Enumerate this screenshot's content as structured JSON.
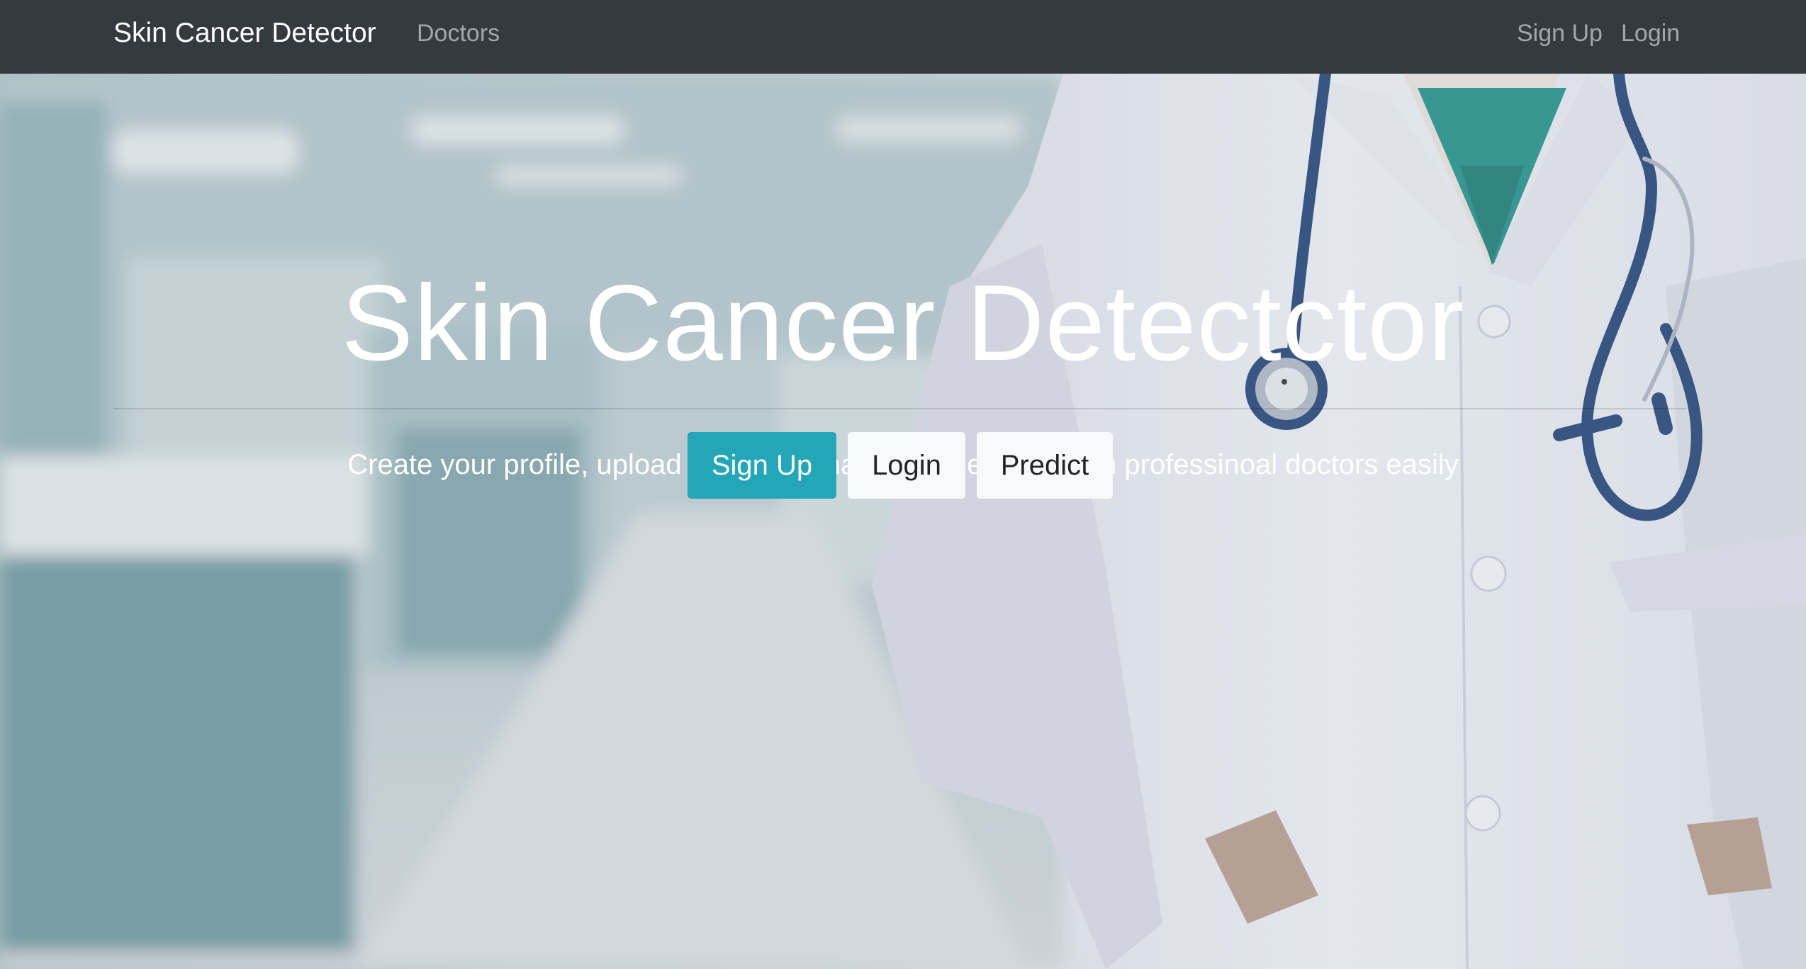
{
  "navbar": {
    "brand": "Skin Cancer Detector",
    "links": {
      "doctors": "Doctors",
      "signup": "Sign Up",
      "login": "Login"
    },
    "background_color": "#343a40"
  },
  "hero": {
    "title": "Skin Cancer Detectctor",
    "subtitle": "Create your profile, upload your skin image and get help from professinoal doctors easily",
    "buttons": {
      "signup": "Sign Up",
      "login": "Login",
      "predict": "Predict"
    },
    "accent_color": "#22a6b8",
    "background_image": "hospital-corridor-doctor-with-stethoscope"
  }
}
